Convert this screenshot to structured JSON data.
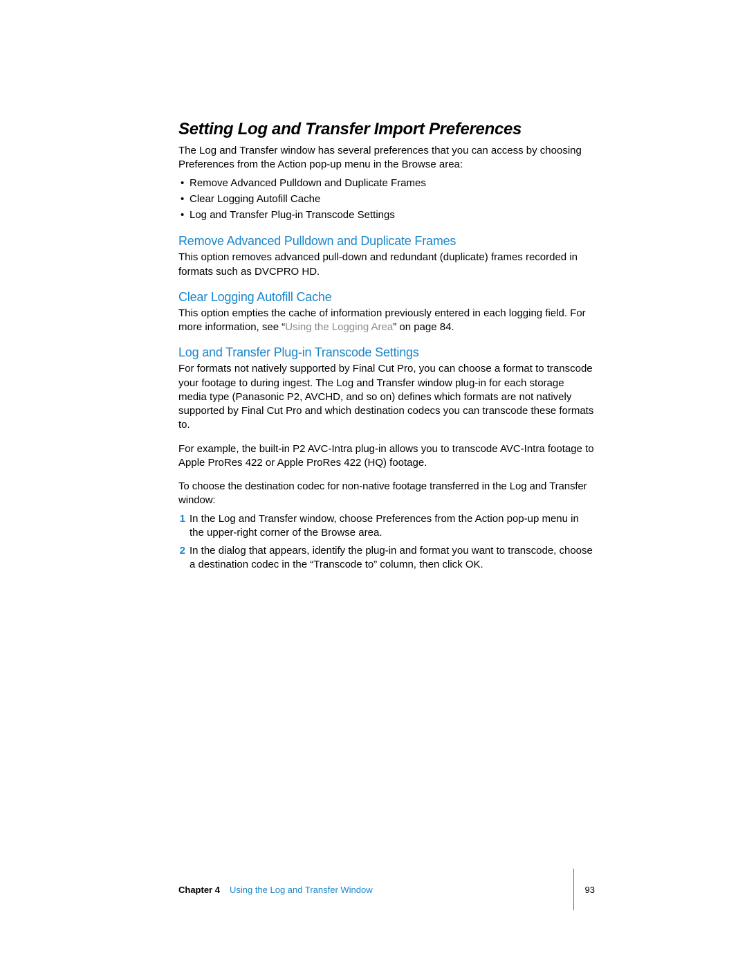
{
  "main": {
    "title": "Setting Log and Transfer Import Preferences",
    "intro": "The Log and Transfer window has several preferences that you can access by choosing Preferences from the Action pop-up menu in the Browse area:",
    "bullets": [
      "Remove Advanced Pulldown and Duplicate Frames",
      "Clear Logging Autofill Cache",
      "Log and Transfer Plug-in Transcode Settings"
    ],
    "sec1": {
      "heading": "Remove Advanced Pulldown and Duplicate Frames",
      "p1": "This option removes advanced pull-down and redundant (duplicate) frames recorded in formats such as DVCPRO HD."
    },
    "sec2": {
      "heading": "Clear Logging Autofill Cache",
      "p1_a": "This option empties the cache of information previously entered in each logging field. For more information, see “",
      "p1_link": "Using the Logging Area",
      "p1_b": "” on page 84."
    },
    "sec3": {
      "heading": "Log and Transfer Plug-in Transcode Settings",
      "p1": "For formats not natively supported by Final Cut Pro, you can choose a format to transcode your footage to during ingest. The Log and Transfer window plug-in for each storage media type (Panasonic P2, AVCHD, and so on) defines which formats are not natively supported by Final Cut Pro and which destination codecs you can transcode these formats to.",
      "p2": "For example, the built-in P2 AVC-Intra plug-in allows you to transcode AVC-Intra footage to Apple ProRes 422 or Apple ProRes 422 (HQ) footage.",
      "task_label": "To choose the destination codec for non-native footage transferred in the Log and Transfer window:",
      "steps": [
        "In the Log and Transfer window, choose Preferences from the Action pop-up menu in the upper-right corner of the Browse area.",
        "In the dialog that appears, identify the plug-in and format you want to transcode, choose a destination codec in the “Transcode to” column, then click OK."
      ]
    }
  },
  "footer": {
    "chapter_label": "Chapter 4",
    "chapter_title": "Using the Log and Transfer Window",
    "page_number": "93"
  }
}
